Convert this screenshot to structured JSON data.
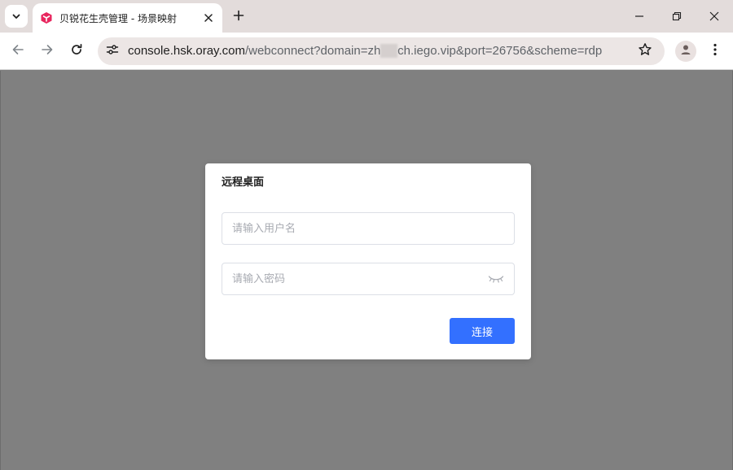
{
  "browser": {
    "tab": {
      "title": "贝锐花生壳管理 - 场景映射"
    },
    "url": {
      "host": "console.hsk.oray.com",
      "path_start": "/webconnect?domain=zh",
      "path_blurred": "     ",
      "path_end": "ch.iego.vip&port=26756&scheme=rdp"
    },
    "icons": {
      "tab_search": "chevron-down-icon",
      "favicon": "oray-logo-icon",
      "tab_close": "close-icon",
      "new_tab": "plus-icon",
      "minimize": "minimize-icon",
      "restore": "restore-icon",
      "close_window": "close-icon",
      "back": "arrow-left-icon",
      "forward": "arrow-right-icon",
      "reload": "reload-icon",
      "site_info": "tune-icon",
      "bookmark": "star-icon",
      "profile": "person-icon",
      "menu": "more-vert-icon"
    }
  },
  "dialog": {
    "title": "远程桌面",
    "username": {
      "value": "",
      "placeholder": "请输入用户名"
    },
    "password": {
      "value": "",
      "placeholder": "请输入密码"
    },
    "connect_label": "连接"
  },
  "colors": {
    "primary": "#3370ff",
    "overlay": "#808080",
    "tabbar": "#e3dcdb",
    "favicon": "#e8265e"
  }
}
